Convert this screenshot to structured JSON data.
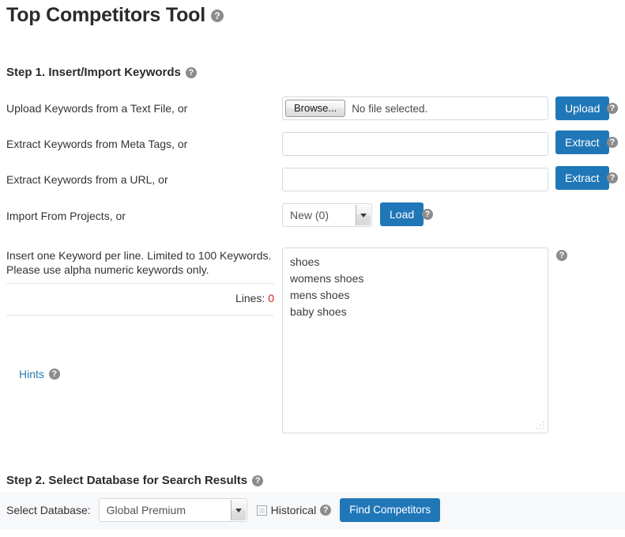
{
  "page": {
    "title": "Top Competitors Tool",
    "title_help": "help-icon"
  },
  "step1": {
    "heading": "Step 1. Insert/Import Keywords",
    "rows": [
      {
        "label": "Upload Keywords from a Text File, or",
        "browse_label": "Browse...",
        "file_status": "No file selected.",
        "action_label": "Upload"
      },
      {
        "label": "Extract Keywords from Meta Tags, or",
        "value": "",
        "placeholder": "",
        "action_label": "Extract"
      },
      {
        "label": "Extract Keywords from a URL, or",
        "value": "",
        "placeholder": "",
        "action_label": "Extract"
      },
      {
        "label": "Import From Projects, or",
        "project_selected": "New (0)",
        "project_options": [
          "New (0)"
        ],
        "action_label": "Load"
      }
    ],
    "instructions_line1": "Insert one Keyword per line. Limited to 100 Keywords.",
    "instructions_line2": "Please use alpha numeric keywords only.",
    "lines_label": "Lines:",
    "lines_count": "0",
    "lines_count_color": "#e01b1b",
    "hints_label": "Hints",
    "keywords_value": "shoes\nwomens shoes\nmens shoes\nbaby shoes",
    "keywords_placeholder": ""
  },
  "step2": {
    "heading": "Step 2. Select Database for Search Results",
    "select_database_label": "Select Database:",
    "database_selected": "Global Premium",
    "database_options": [
      "Global Premium"
    ],
    "historical_label": "Historical",
    "historical_checked": false,
    "find_button_label": "Find Competitors"
  },
  "theme": {
    "accent_blue": "#2077b8",
    "band_background": "#f7f8fa",
    "help_icon_gray": "#8c8c8c",
    "link_blue": "#2a7ab0",
    "border_gray": "#d4d9de"
  }
}
